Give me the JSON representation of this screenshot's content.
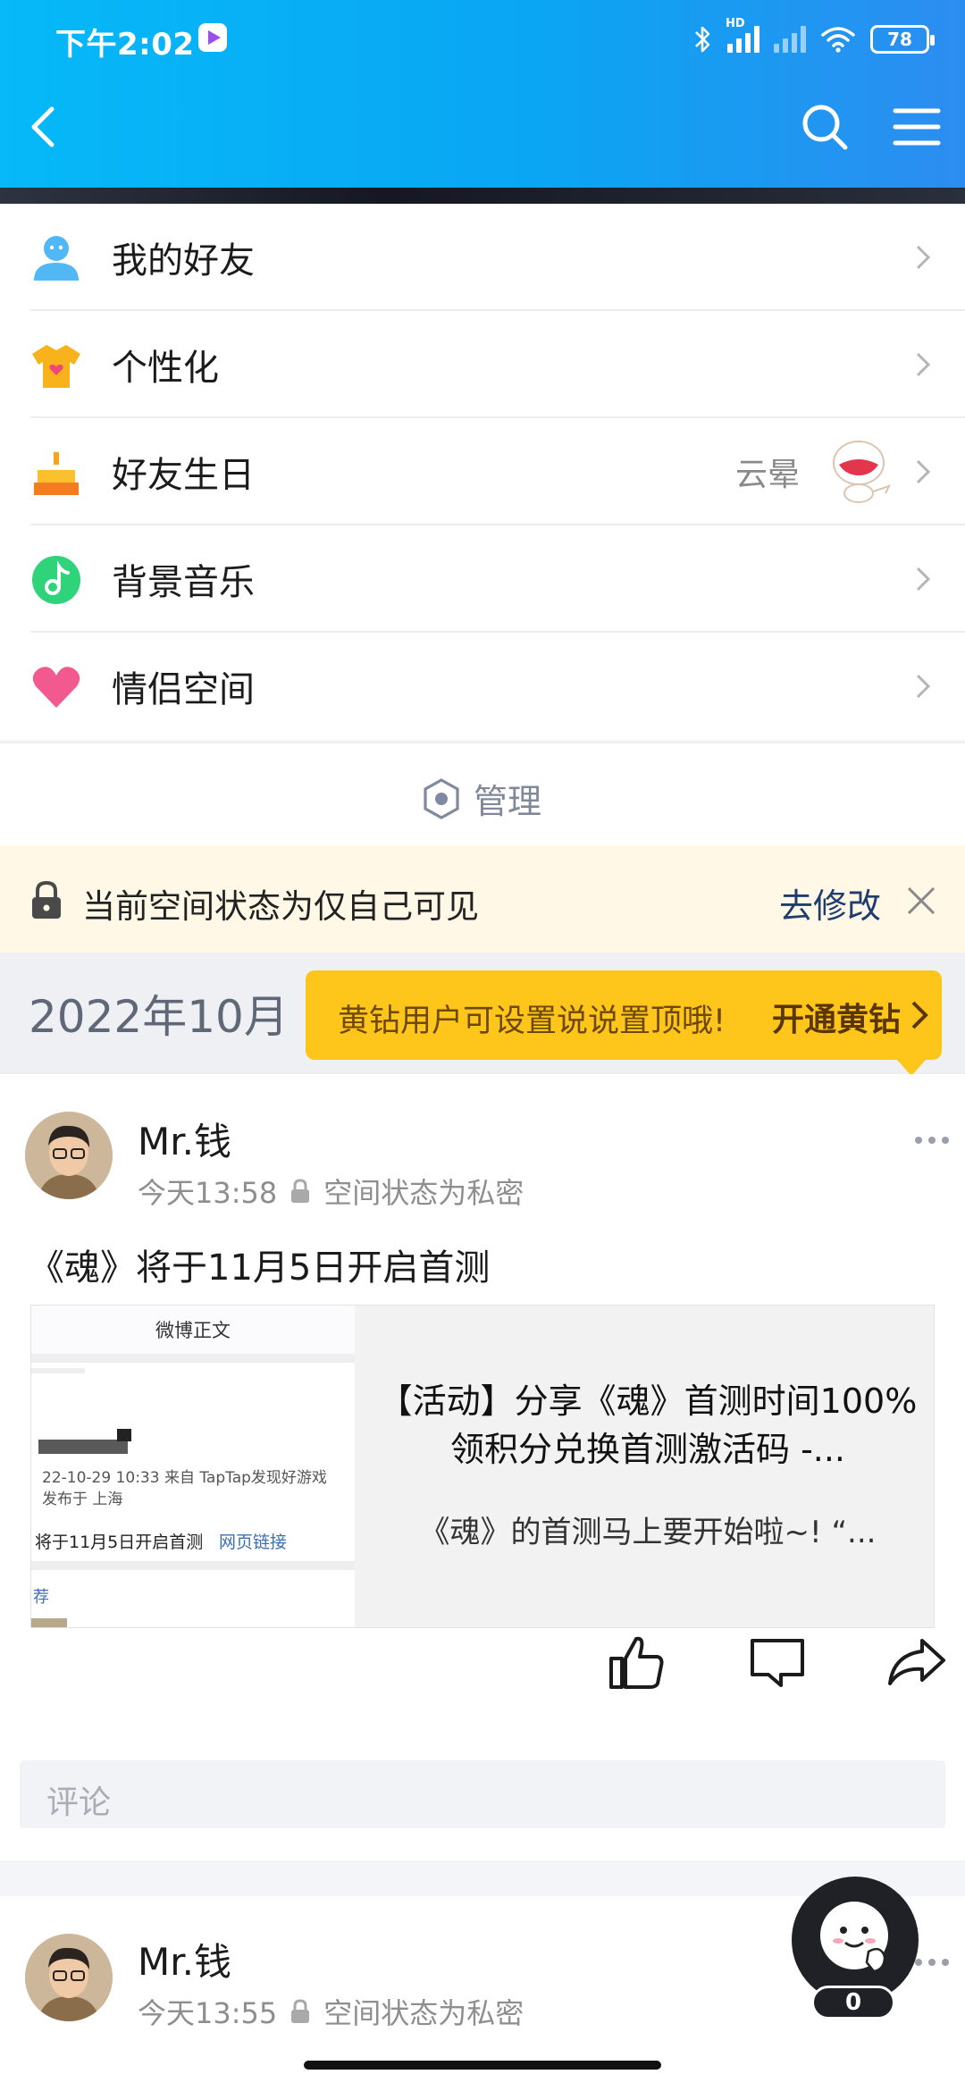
{
  "status_bar": {
    "time": "下午2:02",
    "network_label": "HD",
    "battery_level": "78",
    "icons": [
      "bluetooth-icon",
      "signal-icon",
      "wifi-icon",
      "battery-icon"
    ]
  },
  "nav": {
    "back_icon": "chevron-left-icon",
    "search_icon": "search-icon",
    "menu_icon": "hamburger-menu-icon"
  },
  "menu": {
    "items": [
      {
        "label": "我的好友",
        "value": "",
        "icon": "friends-icon"
      },
      {
        "label": "个性化",
        "value": "",
        "icon": "tshirt-icon"
      },
      {
        "label": "好友生日",
        "value": "云晕",
        "icon": "cake-icon"
      },
      {
        "label": "背景音乐",
        "value": "",
        "icon": "music-note-icon"
      },
      {
        "label": "情侣空间",
        "value": "",
        "icon": "heart-icon"
      }
    ],
    "manage_label": "管理"
  },
  "notice": {
    "text": "当前空间状态为仅自己可见",
    "action": "去修改"
  },
  "timeline": {
    "month": "2022年10月",
    "promo_text": "黄钻用户可设置说说置顶哦!",
    "promo_cta": "开通黄钻"
  },
  "posts": [
    {
      "author": "Mr.钱",
      "time": "今天13:58",
      "privacy": "空间状态为私密",
      "text": "《魂》将于11月5日开启首测",
      "share": {
        "thumb_header": "微博正文",
        "thumb_line1": "22-10-29 10:33  来自 TapTap发现好游戏",
        "thumb_line2": "发布于 上海",
        "thumb_line3": "将于11月5日开启首测",
        "thumb_link": "网页链接",
        "thumb_tag": "荐",
        "title": "【活动】分享《魂》首测时间100%领积分兑换首测激活码 -...",
        "description": "《魂》的首测马上要开始啦~! “..."
      },
      "comment_placeholder": "评论"
    },
    {
      "author": "Mr.钱",
      "time": "今天13:55",
      "privacy": "空间状态为私密"
    }
  ],
  "floating": {
    "badge_count": "0"
  },
  "colors": {
    "header_start": "#06b9f8",
    "header_end": "#2c8df0",
    "promo_yellow": "#fec51a",
    "notice_bg": "#fff8e6",
    "link_blue": "#1f3c6e"
  }
}
